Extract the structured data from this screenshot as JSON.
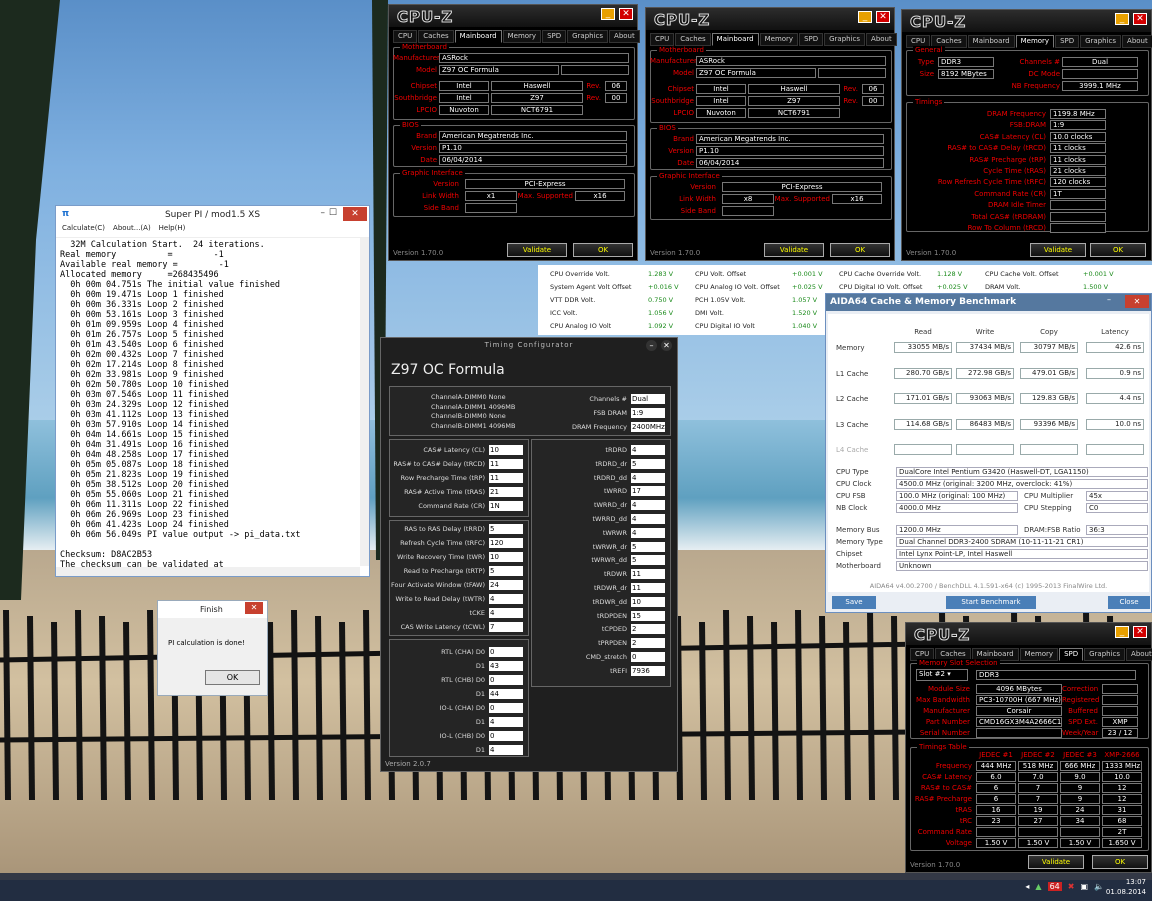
{
  "cpuz_mb1": {
    "tabs": [
      "CPU",
      "Caches",
      "Mainboard",
      "Memory",
      "SPD",
      "Graphics",
      "About"
    ],
    "active_tab": "Mainboard",
    "motherboard_group": "Motherboard",
    "manufacturer_label": "Manufacturer",
    "manufacturer": "ASRock",
    "model_label": "Model",
    "model": "Z97 OC Formula",
    "chipset_label": "Chipset",
    "chipset_vendor": "Intel",
    "chipset_name": "Haswell",
    "chipset_rev_label": "Rev.",
    "chipset_rev": "06",
    "southbridge_label": "Southbridge",
    "sb_vendor": "Intel",
    "sb_name": "Z97",
    "sb_rev_label": "Rev.",
    "sb_rev": "00",
    "lpcio_label": "LPCIO",
    "lpcio_vendor": "Nuvoton",
    "lpcio_name": "NCT6791",
    "bios_group": "BIOS",
    "brand_label": "Brand",
    "brand": "American Megatrends Inc.",
    "version_label": "Version",
    "version": "P1.10",
    "date_label": "Date",
    "date": "06/04/2014",
    "gi_group": "Graphic Interface",
    "gi_version_label": "Version",
    "gi_version": "PCI-Express",
    "link_width_label": "Link Width",
    "link_width": "x1",
    "max_supported_label": "Max. Supported",
    "max_supported": "x16",
    "side_band_label": "Side Band",
    "footer_version": "Version 1.70.0",
    "validate": "Validate",
    "ok": "OK"
  },
  "cpuz_mb2": {
    "manufacturer": "ASRock",
    "model": "Z97 OC Formula",
    "chipset_vendor": "Intel",
    "chipset_name": "Haswell",
    "chipset_rev": "06",
    "sb_vendor": "Intel",
    "sb_name": "Z97",
    "sb_rev": "00",
    "lpcio_vendor": "Nuvoton",
    "lpcio_name": "NCT6791",
    "brand": "American Megatrends Inc.",
    "version": "P1.10",
    "date": "06/04/2014",
    "gi_version": "PCI-Express",
    "link_width": "x8",
    "max_supported": "x16",
    "footer_version": "Version 1.70.0",
    "validate": "Validate",
    "ok": "OK"
  },
  "cpuz_mem": {
    "active_tab": "Memory",
    "general_group": "General",
    "type_label": "Type",
    "type": "DDR3",
    "size_label": "Size",
    "size": "8192 MBytes",
    "channels_label": "Channels #",
    "channels": "Dual",
    "dc_mode_label": "DC Mode",
    "nb_freq_label": "NB Frequency",
    "nb_freq": "3999.1 MHz",
    "timings_group": "Timings",
    "timings": [
      {
        "label": "DRAM Frequency",
        "value": "1199.8 MHz"
      },
      {
        "label": "FSB:DRAM",
        "value": "1:9"
      },
      {
        "label": "CAS# Latency (CL)",
        "value": "10.0 clocks"
      },
      {
        "label": "RAS# to CAS# Delay (tRCD)",
        "value": "11 clocks"
      },
      {
        "label": "RAS# Precharge (tRP)",
        "value": "11 clocks"
      },
      {
        "label": "Cycle Time (tRAS)",
        "value": "21 clocks"
      },
      {
        "label": "Row Refresh Cycle Time (tRFC)",
        "value": "120 clocks"
      },
      {
        "label": "Command Rate (CR)",
        "value": "1T"
      },
      {
        "label": "DRAM Idle Timer",
        "value": ""
      },
      {
        "label": "Total CAS# (tRDRAM)",
        "value": ""
      },
      {
        "label": "Row To Column (tRCD)",
        "value": ""
      }
    ],
    "footer_version": "Version 1.70.0",
    "validate": "Validate",
    "ok": "OK"
  },
  "cpuz_spd": {
    "active_tab": "SPD",
    "slot_group": "Memory Slot Selection",
    "slot": "Slot #2",
    "slot_type": "DDR3",
    "module_size_label": "Module Size",
    "module_size": "4096 MBytes",
    "max_bw_label": "Max Bandwidth",
    "max_bw": "PC3-10700H (667 MHz)",
    "mfr_label": "Manufacturer",
    "mfr": "Corsair",
    "part_label": "Part Number",
    "part": "CMD16GX3M4A2666C10",
    "serial_label": "Serial Number",
    "correction_label": "Correction",
    "registered_label": "Registered",
    "buffered_label": "Buffered",
    "spd_ext_label": "SPD Ext.",
    "spd_ext": "XMP",
    "week_label": "Week/Year",
    "week": "23 / 12",
    "table_group": "Timings Table",
    "cols": [
      "JEDEC #1",
      "JEDEC #2",
      "JEDEC #3",
      "XMP-2666"
    ],
    "rows": [
      {
        "label": "Frequency",
        "vals": [
          "444 MHz",
          "518 MHz",
          "666 MHz",
          "1333 MHz"
        ]
      },
      {
        "label": "CAS# Latency",
        "vals": [
          "6.0",
          "7.0",
          "9.0",
          "10.0"
        ]
      },
      {
        "label": "RAS# to CAS#",
        "vals": [
          "6",
          "7",
          "9",
          "12"
        ]
      },
      {
        "label": "RAS# Precharge",
        "vals": [
          "6",
          "7",
          "9",
          "12"
        ]
      },
      {
        "label": "tRAS",
        "vals": [
          "16",
          "19",
          "24",
          "31"
        ]
      },
      {
        "label": "tRC",
        "vals": [
          "23",
          "27",
          "34",
          "68"
        ]
      },
      {
        "label": "Command Rate",
        "vals": [
          "",
          "",
          "",
          "2T"
        ]
      },
      {
        "label": "Voltage",
        "vals": [
          "1.50 V",
          "1.50 V",
          "1.50 V",
          "1.650 V"
        ]
      }
    ],
    "footer_version": "Version 1.70.0",
    "validate": "Validate",
    "ok": "OK"
  },
  "superpi": {
    "title": "Super PI / mod1.5 XS",
    "menu": [
      "Calculate(C)",
      "About...(A)",
      "Help(H)"
    ],
    "log": "  32M Calculation Start.  24 iterations.\nReal memory          =        -1\nAvailable real memory =        -1\nAllocated memory     =268435496\n  0h 00m 04.751s The initial value finished\n  0h 00m 19.471s Loop 1 finished\n  0h 00m 36.331s Loop 2 finished\n  0h 00m 53.161s Loop 3 finished\n  0h 01m 09.959s Loop 4 finished\n  0h 01m 26.757s Loop 5 finished\n  0h 01m 43.540s Loop 6 finished\n  0h 02m 00.432s Loop 7 finished\n  0h 02m 17.214s Loop 8 finished\n  0h 02m 33.981s Loop 9 finished\n  0h 02m 50.780s Loop 10 finished\n  0h 03m 07.546s Loop 11 finished\n  0h 03m 24.329s Loop 12 finished\n  0h 03m 41.112s Loop 13 finished\n  0h 03m 57.910s Loop 14 finished\n  0h 04m 14.661s Loop 15 finished\n  0h 04m 31.491s Loop 16 finished\n  0h 04m 48.258s Loop 17 finished\n  0h 05m 05.087s Loop 18 finished\n  0h 05m 21.823s Loop 19 finished\n  0h 05m 38.512s Loop 20 finished\n  0h 05m 55.060s Loop 21 finished\n  0h 06m 11.311s Loop 22 finished\n  0h 06m 26.969s Loop 23 finished\n  0h 06m 41.423s Loop 24 finished\n  0h 06m 56.049s PI value output -> pi_data.txt\n\nChecksum: D8AC2B53\nThe checksum can be validated at"
  },
  "finish": {
    "title": "Finish",
    "message": "PI calculation is done!",
    "ok": "OK"
  },
  "timing": {
    "title": "Timing Configurator",
    "board": "Z97 OC Formula",
    "dimms": [
      "ChannelA-DIMM0 None",
      "ChannelA-DIMM1 4096MB",
      "ChannelB-DIMM0 None",
      "ChannelB-DIMM1 4096MB"
    ],
    "channels_label": "Channels #",
    "channels": "Dual",
    "fsb_label": "FSB DRAM",
    "fsb": "1:9",
    "dram_freq_label": "DRAM Frequency",
    "dram_freq": "2400MHz",
    "primary": [
      {
        "label": "CAS# Latency (CL)",
        "value": "10"
      },
      {
        "label": "RAS# to CAS# Delay (tRCD)",
        "value": "11"
      },
      {
        "label": "Row Precharge Time (tRP)",
        "value": "11"
      },
      {
        "label": "RAS# Active Time (tRAS)",
        "value": "21"
      },
      {
        "label": "Command Rate (CR)",
        "value": "1N"
      }
    ],
    "secondary": [
      {
        "label": "RAS to RAS Delay (tRRD)",
        "value": "5"
      },
      {
        "label": "Refresh Cycle Time (tRFC)",
        "value": "120"
      },
      {
        "label": "Write Recovery Time (tWR)",
        "value": "10"
      },
      {
        "label": "Read to Precharge (tRTP)",
        "value": "5"
      },
      {
        "label": "Four Activate Window (tFAW)",
        "value": "24"
      },
      {
        "label": "Write to Read Delay (tWTR)",
        "value": "4"
      },
      {
        "label": "tCKE",
        "value": "4"
      },
      {
        "label": "CAS Write Latency (tCWL)",
        "value": "7"
      }
    ],
    "rtl": [
      {
        "label": "RTL (CHA) D0",
        "value": "0"
      },
      {
        "label": "D1",
        "value": "43"
      },
      {
        "label": "RTL (CHB) D0",
        "value": "0"
      },
      {
        "label": "D1",
        "value": "44"
      },
      {
        "label": "IO-L (CHA) D0",
        "value": "0"
      },
      {
        "label": "D1",
        "value": "4"
      },
      {
        "label": "IO-L (CHB) D0",
        "value": "0"
      },
      {
        "label": "D1",
        "value": "4"
      }
    ],
    "right": [
      {
        "label": "tRDRD",
        "value": "4"
      },
      {
        "label": "tRDRD_dr",
        "value": "5"
      },
      {
        "label": "tRDRD_dd",
        "value": "4"
      },
      {
        "label": "tWRRD",
        "value": "17"
      },
      {
        "label": "tWRRD_dr",
        "value": "4"
      },
      {
        "label": "tWRRD_dd",
        "value": "4"
      },
      {
        "label": "tWRWR",
        "value": "4"
      },
      {
        "label": "tWRWR_dr",
        "value": "5"
      },
      {
        "label": "tWRWR_dd",
        "value": "5"
      },
      {
        "label": "tRDWR",
        "value": "11"
      },
      {
        "label": "tRDWR_dr",
        "value": "11"
      },
      {
        "label": "tRDWR_dd",
        "value": "10"
      },
      {
        "label": "tRDPDEN",
        "value": "15"
      },
      {
        "label": "tCPDED",
        "value": "2"
      },
      {
        "label": "tPRPDEN",
        "value": "2"
      },
      {
        "label": "CMD_stretch",
        "value": "0"
      },
      {
        "label": "tREFI",
        "value": "7936"
      }
    ],
    "version": "Version 2.0.7"
  },
  "voltages": [
    {
      "label": "CPU Override Volt.",
      "value": "1.283 V"
    },
    {
      "label": "CPU Volt. Offset",
      "value": "+0.001 V"
    },
    {
      "label": "CPU Cache Override Volt.",
      "value": "1.128 V"
    },
    {
      "label": "CPU Cache Volt. Offset",
      "value": "+0.001 V"
    },
    {
      "label": "System Agent Volt Offset",
      "value": "+0.016 V"
    },
    {
      "label": "CPU Analog IO Volt. Offset",
      "value": "+0.025 V"
    },
    {
      "label": "CPU Digital IO Volt. Offset",
      "value": "+0.025 V"
    },
    {
      "label": "DRAM Volt.",
      "value": "1.500 V"
    },
    {
      "label": "VTT DDR Volt.",
      "value": "0.750 V"
    },
    {
      "label": "PCH 1.05V Volt.",
      "value": "1.057 V"
    },
    {
      "label": "ICC Volt.",
      "value": "1.056 V"
    },
    {
      "label": "DMI Volt.",
      "value": "1.520 V"
    },
    {
      "label": "CPU Analog IO Volt",
      "value": "1.092 V"
    },
    {
      "label": "CPU Digital IO Volt",
      "value": "1.040 V"
    }
  ],
  "aida": {
    "title": "AIDA64 Cache & Memory Benchmark",
    "headers": [
      "Read",
      "Write",
      "Copy",
      "Latency"
    ],
    "rows": [
      {
        "label": "Memory",
        "vals": [
          "33055 MB/s",
          "37434 MB/s",
          "30797 MB/s",
          "42.6 ns"
        ]
      },
      {
        "label": "L1 Cache",
        "vals": [
          "280.70 GB/s",
          "272.98 GB/s",
          "479.01 GB/s",
          "0.9 ns"
        ]
      },
      {
        "label": "L2 Cache",
        "vals": [
          "171.01 GB/s",
          "93063 MB/s",
          "129.83 GB/s",
          "4.4 ns"
        ]
      },
      {
        "label": "L3 Cache",
        "vals": [
          "114.68 GB/s",
          "86483 MB/s",
          "93396 MB/s",
          "10.0 ns"
        ]
      },
      {
        "label": "L4 Cache",
        "vals": [
          "",
          "",
          "",
          ""
        ]
      }
    ],
    "cpu_type_label": "CPU Type",
    "cpu_type": "DualCore Intel Pentium G3420  (Haswell-DT, LGA1150)",
    "cpu_clock_label": "CPU Clock",
    "cpu_clock": "4500.0 MHz  (original: 3200 MHz, overclock: 41%)",
    "cpu_fsb_label": "CPU FSB",
    "cpu_fsb": "100.0 MHz  (original: 100 MHz)",
    "cpu_mult_label": "CPU Multiplier",
    "cpu_mult": "45x",
    "nb_clock_label": "NB Clock",
    "nb_clock": "4000.0 MHz",
    "cpu_step_label": "CPU Stepping",
    "cpu_step": "C0",
    "mem_bus_label": "Memory Bus",
    "mem_bus": "1200.0 MHz",
    "ratio_label": "DRAM:FSB Ratio",
    "ratio": "36:3",
    "mem_type_label": "Memory Type",
    "mem_type": "Dual Channel DDR3-2400 SDRAM  (10-11-11-21 CR1)",
    "chipset_label": "Chipset",
    "chipset": "Intel Lynx Point-LP, Intel Haswell",
    "mobo_label": "Motherboard",
    "mobo": "Unknown",
    "footer": "AIDA64 v4.00.2700 / BenchDLL 4.1.591-x64  (c) 1995-2013 FinalWire Ltd.",
    "save": "Save",
    "start": "Start Benchmark",
    "close": "Close"
  },
  "clock": {
    "time": "13:07",
    "date": "01.08.2014"
  },
  "tray_badge": "64"
}
